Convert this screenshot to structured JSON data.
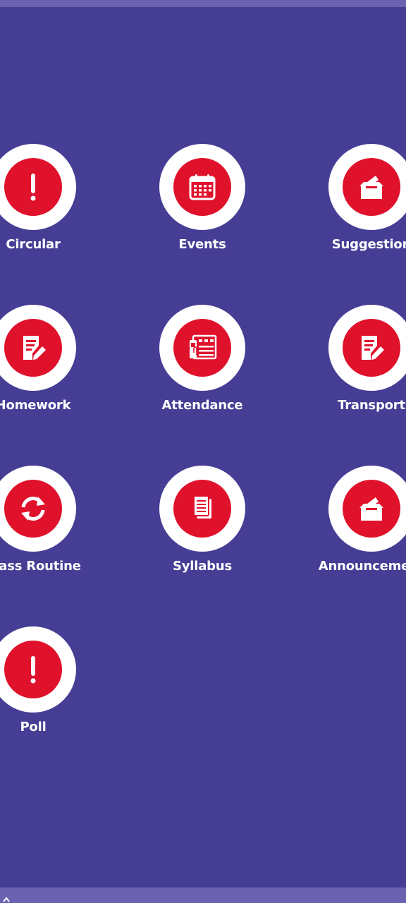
{
  "menu": {
    "items": [
      {
        "label": "Circular",
        "icon": "exclamation-icon"
      },
      {
        "label": "Events",
        "icon": "calendar-icon"
      },
      {
        "label": "Suggestion",
        "icon": "ballot-box-icon"
      },
      {
        "label": "Homework",
        "icon": "edit-note-icon"
      },
      {
        "label": "Attendance",
        "icon": "biometric-attendance-icon"
      },
      {
        "label": "Transport",
        "icon": "edit-note-icon"
      },
      {
        "label": "Class Routine",
        "icon": "refresh-icon"
      },
      {
        "label": "Syllabus",
        "icon": "documents-icon"
      },
      {
        "label": "Announcement",
        "icon": "ballot-box-icon"
      },
      {
        "label": "Poll",
        "icon": "exclamation-icon"
      }
    ]
  },
  "colors": {
    "background": "#463e95",
    "strip": "#6a62b0",
    "icon_circle": "#e0112b",
    "ring": "#ffffff",
    "label": "#ffffff"
  }
}
